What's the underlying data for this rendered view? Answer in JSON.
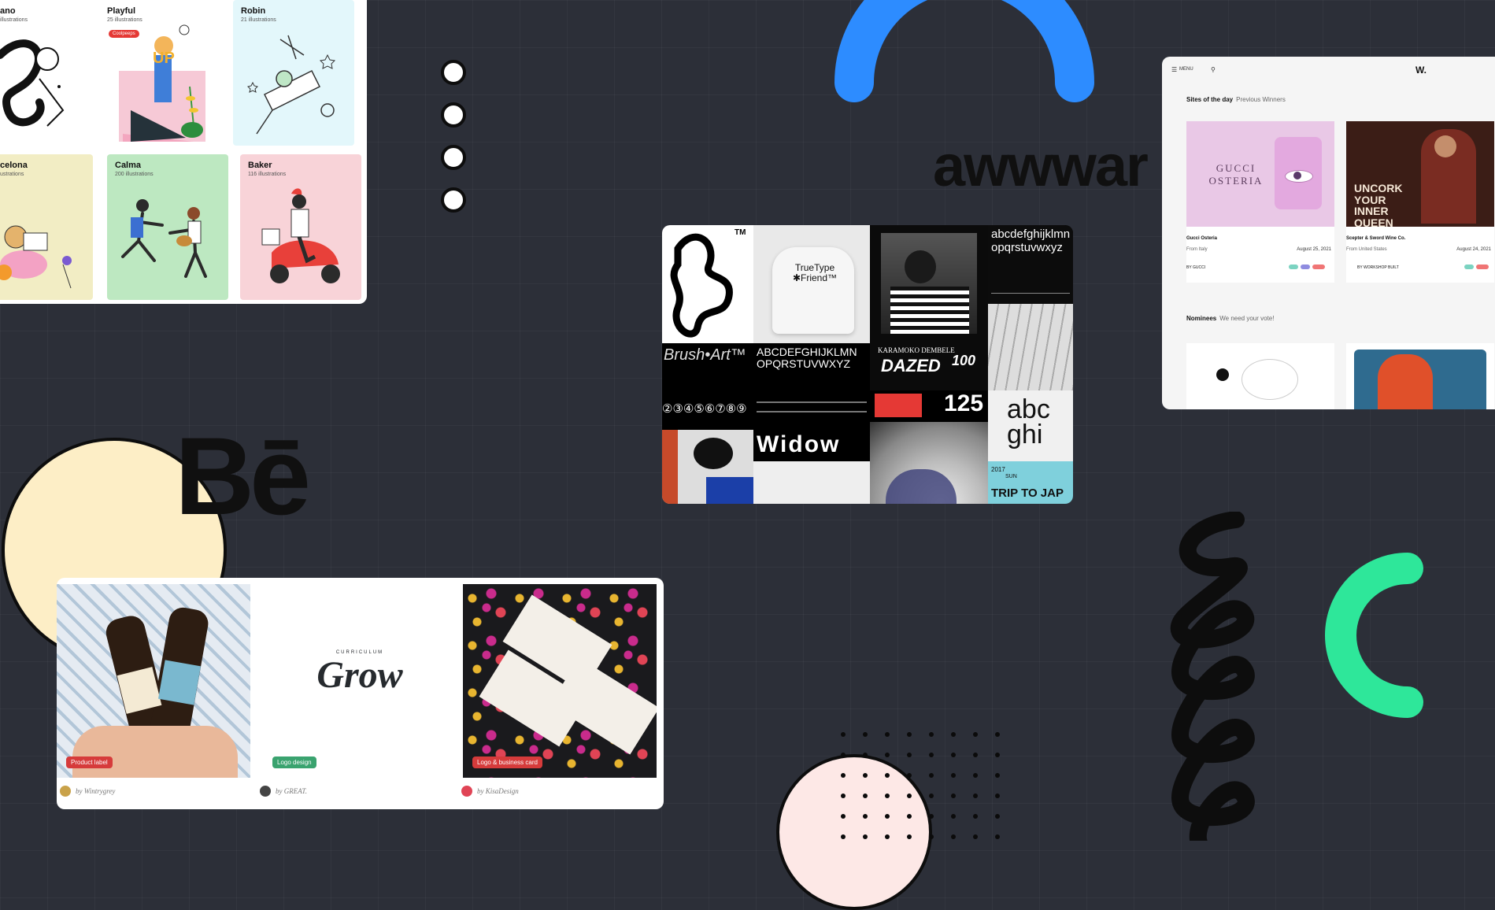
{
  "colors": {
    "background": "#2c2f38",
    "blue_arch": "#2d8cff",
    "green_arc": "#2ee79a",
    "cream_circle": "#fdeec6",
    "pink_circle": "#fde8e6",
    "black_shapes": "#0d0d0d"
  },
  "illustrations": {
    "cards": [
      {
        "title": "ano",
        "count": "illustrations"
      },
      {
        "title": "Playful",
        "count": "25 illustrations",
        "badge": "Coolpeeps"
      },
      {
        "title": "Robin",
        "count": "21 illustrations"
      },
      {
        "title": "celona",
        "count": "ustrations"
      },
      {
        "title": "Calma",
        "count": "200 illustrations"
      },
      {
        "title": "Baker",
        "count": "116 illustrations"
      }
    ]
  },
  "awwwards": {
    "wordmark": "awwwar",
    "menu_label": "MENU",
    "logo": "W.",
    "sites_of_day": "Sites of the day",
    "previous_winners": "Previous Winners",
    "cards": [
      {
        "thumb_title": "GUCCI OSTERIA",
        "name": "Gucci Osteria",
        "from": "From Italy",
        "date": "August 25, 2021",
        "by": "BY GUCCI"
      },
      {
        "thumb_title": "UNCORK YOUR INNER QUEEN",
        "name": "Scepter & Sword Wine Co.",
        "from": "From United States",
        "date": "August 24, 2021",
        "by": "BY WORKSHOP BUILT"
      }
    ],
    "nominees": "Nominees",
    "need_vote": "We need your vote!"
  },
  "collage": {
    "true_type": "TrueType\n✱Friend™",
    "tm": "TM",
    "lower_abc": "abcdefghijklmn\nopqrstuvwxyz",
    "brush_art": "Brush•Art™",
    "upper_abc": "ABCDEFGHIJKLMN\nOPQRSTUVWXYZ",
    "karamoko": "KARAMOKO DEMBELE",
    "dazed": "DAZED",
    "dazed_num": "100",
    "numbers": "②③④⑤⑥⑦⑧⑨",
    "widow": "Widow",
    "abc_big": "abc\nghi",
    "trip": "TRIP TO JAP",
    "year": "2017",
    "sun": "SUN",
    "num125": "125"
  },
  "behance": {
    "wordmark": "Bē",
    "cards": [
      {
        "tag": "Product label",
        "tag_color": "#d63b3b",
        "credit": "by Wintrygrey"
      },
      {
        "tag": "Logo design",
        "tag_color": "#3aa36f",
        "credit": "by GREAT.",
        "logo_text": "Grow",
        "logo_sub": "CURRICULUM"
      },
      {
        "tag": "Logo & business card",
        "tag_color": "#d63b3b",
        "credit": "by KisaDesign"
      }
    ]
  }
}
